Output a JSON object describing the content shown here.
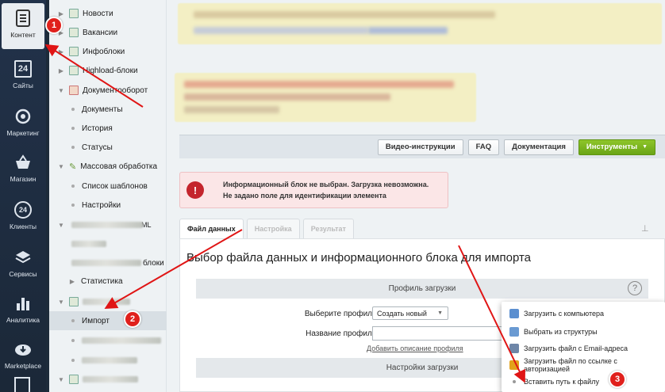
{
  "rail": {
    "items": [
      {
        "label": "Контент",
        "icon": "document-icon"
      },
      {
        "label": "Сайты",
        "icon": "calendar-24-icon",
        "glyph": "24"
      },
      {
        "label": "Маркетинг",
        "icon": "target-icon"
      },
      {
        "label": "Магазин",
        "icon": "cart-icon"
      },
      {
        "label": "Клиенты",
        "icon": "clients-24-icon",
        "glyph": "24"
      },
      {
        "label": "Сервисы",
        "icon": "layers-icon"
      },
      {
        "label": "Аналитика",
        "icon": "bar-chart-icon"
      },
      {
        "label": "Marketplace",
        "icon": "cloud-download-icon"
      }
    ]
  },
  "tree": {
    "items": [
      {
        "label": "Новости"
      },
      {
        "label": "Вакансии"
      },
      {
        "label": "Инфоблоки"
      },
      {
        "label": "Highload-блоки"
      },
      {
        "label": "Документооборот"
      },
      {
        "label": "Документы"
      },
      {
        "label": "История"
      },
      {
        "label": "Статусы"
      },
      {
        "label": "Массовая обработка"
      },
      {
        "label": "Список шаблонов"
      },
      {
        "label": "Настройки"
      },
      {
        "label": "Статистика"
      },
      {
        "label": "Импорт"
      }
    ],
    "fragments": {
      "ml": "ML",
      "bloki": "блоки"
    }
  },
  "toolbar": {
    "video_label": "Видео-инструкции",
    "faq_label": "FAQ",
    "docs_label": "Документация",
    "tools_label": "Инструменты"
  },
  "alert": {
    "icon": "!",
    "line1": "Информационный блок не выбран. Загрузка невозможна.",
    "line2": "Не задано поле для идентификации элемента"
  },
  "tabs": [
    {
      "label": "Файл данных"
    },
    {
      "label": "Настройка"
    },
    {
      "label": "Результат"
    }
  ],
  "panel": {
    "title": "Выбор файла данных и информационного блока для импорта",
    "profile_section": "Профиль загрузки",
    "help_glyph": "?",
    "profile_label": "Выберите профиль:",
    "profile_value": "Создать новый",
    "name_label": "Название профиля:",
    "add_desc_link": "Добавить описание профиля",
    "load_section": "Настройки загрузки"
  },
  "popup": {
    "items": [
      {
        "label": "Загрузить с компьютера",
        "color": "#5b8fd0"
      },
      {
        "label": "Выбрать из структуры",
        "color": "#6a9ad2"
      },
      {
        "label": "Загрузить файл с Email-адреса",
        "color": "#6e86a8"
      },
      {
        "label": "Загрузить файл по ссылке с авторизацией",
        "color": "#e3a21a"
      },
      {
        "label": "Вставить путь к файлу",
        "color": "#999999"
      }
    ]
  },
  "badges": [
    "1",
    "2",
    "3"
  ],
  "colors": {
    "accent_green": "#7ab51d",
    "badge_red": "#e0201c",
    "arrow_red": "#e01515"
  }
}
